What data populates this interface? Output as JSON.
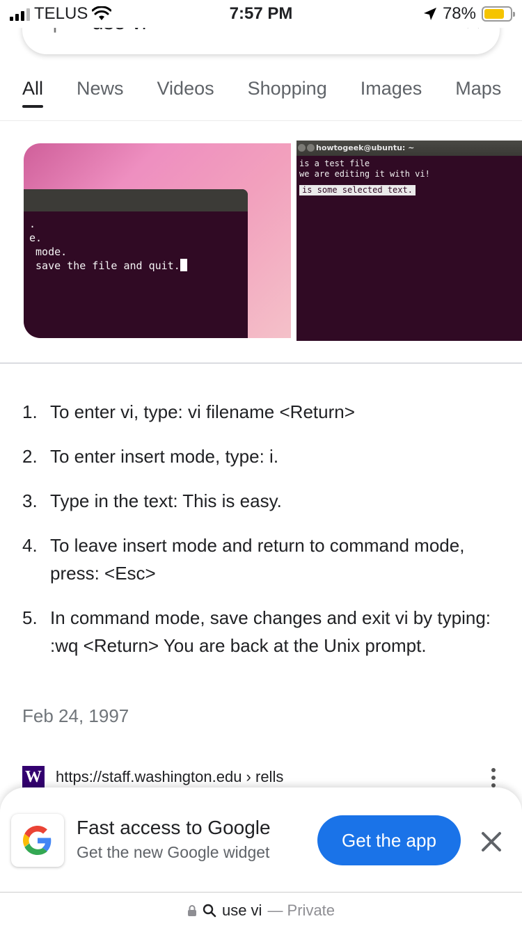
{
  "status_bar": {
    "carrier": "TELUS",
    "time": "7:57 PM",
    "battery_percent": "78%",
    "battery_level": 0.78,
    "battery_color": "#f5c400"
  },
  "search": {
    "query": "use vi",
    "search_icon": "search-icon",
    "clear_icon": "close-icon"
  },
  "tabs": [
    "All",
    "News",
    "Videos",
    "Shopping",
    "Images",
    "Maps"
  ],
  "active_tab": "All",
  "images": {
    "left": {
      "lines": [
        ".",
        "e.",
        " mode.",
        " save the file and quit."
      ]
    },
    "right": {
      "title": "howtogeek@ubuntu: ~",
      "lines": [
        "is a test file",
        "we are editing it with vi!"
      ],
      "selected": "is some selected text."
    }
  },
  "steps": [
    {
      "num": "1.",
      "text": "To enter vi, type: vi filename <Return>"
    },
    {
      "num": "2.",
      "text": "To enter insert mode, type: i."
    },
    {
      "num": "3.",
      "text": "Type in the text: This is easy."
    },
    {
      "num": "4.",
      "text": "To leave insert mode and return to command mode, press: <Esc>"
    },
    {
      "num": "5.",
      "text": "In command mode, save changes and exit vi by typing: :wq <Return> You are back at the Unix prompt."
    }
  ],
  "date": "Feb 24, 1997",
  "source": {
    "favicon_letter": "W",
    "url": "https://staff.washington.edu › rells"
  },
  "promo": {
    "title": "Fast access to Google",
    "subtitle": "Get the new Google widget",
    "button": "Get the app",
    "accent": "#1a73e8"
  },
  "address_bar": {
    "query": "use vi",
    "mode": "— Private"
  }
}
